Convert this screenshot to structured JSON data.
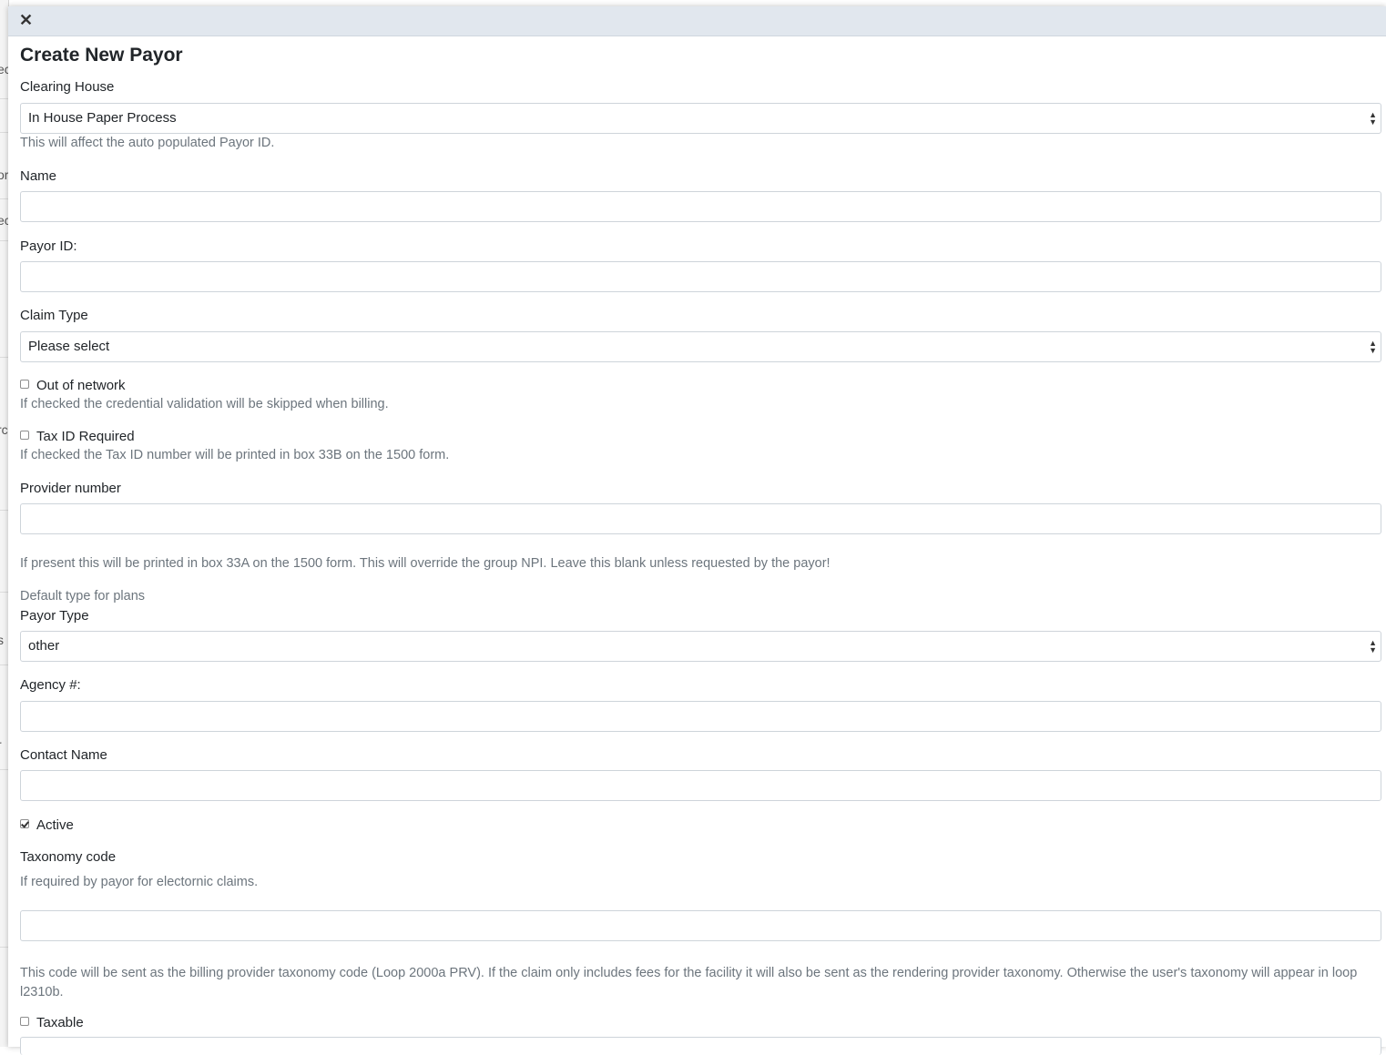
{
  "background": {
    "fragments": [
      "ec",
      "or",
      "ec",
      "rc",
      "s",
      "r"
    ]
  },
  "modal": {
    "close_icon": "close-icon",
    "title": "Create New Payor",
    "clearing_house": {
      "label": "Clearing House",
      "value": "In House Paper Process",
      "help": "This will affect the auto populated Payor ID."
    },
    "name": {
      "label": "Name",
      "value": ""
    },
    "payor_id": {
      "label": "Payor ID:",
      "value": ""
    },
    "claim_type": {
      "label": "Claim Type",
      "value": "Please select"
    },
    "out_of_network": {
      "label": "Out of network",
      "checked": false,
      "help": "If checked the credential validation will be skipped when billing."
    },
    "tax_id_required": {
      "label": "Tax ID Required",
      "checked": false,
      "help": "If checked the Tax ID number will be printed in box 33B on the 1500 form."
    },
    "provider_number": {
      "label": "Provider number",
      "value": "",
      "help": "If present this will be printed in box 33A on the 1500 form. This will override the group NPI. Leave this blank unless requested by the payor!"
    },
    "default_type_heading": "Default type for plans",
    "payor_type": {
      "label": "Payor Type",
      "value": "other"
    },
    "agency_number": {
      "label": "Agency #:",
      "value": ""
    },
    "contact_name": {
      "label": "Contact Name",
      "value": ""
    },
    "active": {
      "label": "Active",
      "checked": true
    },
    "taxonomy_code": {
      "label": "Taxonomy code",
      "help_top": "If required by payor for electornic claims.",
      "value": "",
      "help_bottom": "This code will be sent as the billing provider taxonomy code (Loop 2000a PRV). If the claim only includes fees for the facility it will also be sent as the rendering provider taxonomy. Otherwise the user's taxonomy will appear in loop l2310b."
    },
    "taxable": {
      "label": "Taxable",
      "checked": false
    }
  }
}
